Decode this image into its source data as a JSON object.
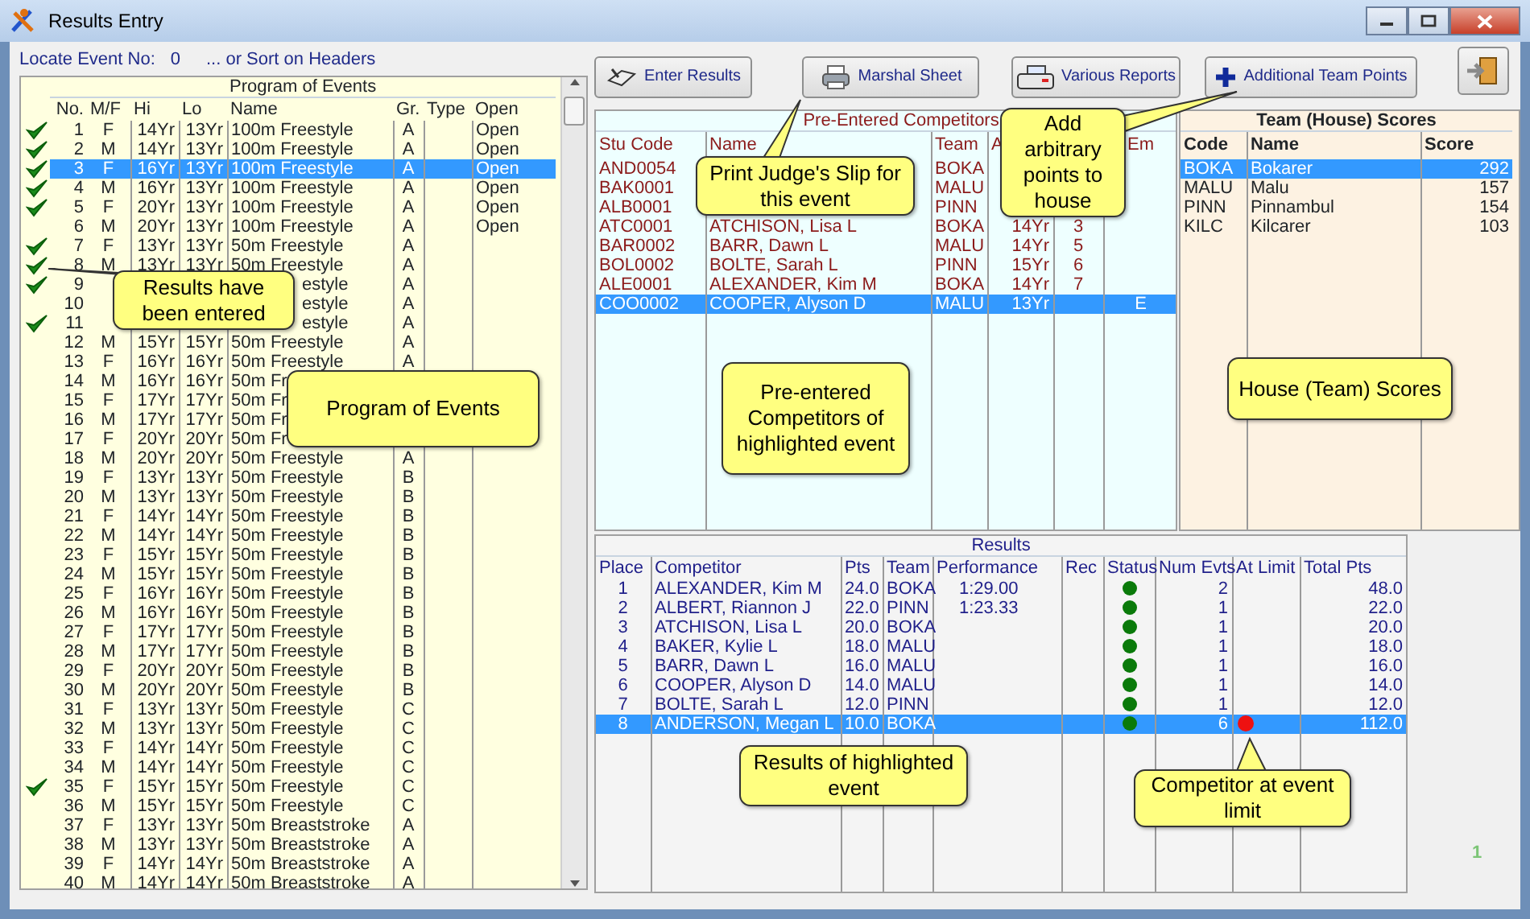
{
  "window": {
    "title": "Results Entry"
  },
  "locate": {
    "label": "Locate Event No:",
    "value": "0",
    "hint": "... or Sort on Headers"
  },
  "events": {
    "title": "Program of Events",
    "columns": [
      "No.",
      "M/F",
      "Hi",
      "Lo",
      "Name",
      "Gr.",
      "Type",
      "Open"
    ],
    "rows": [
      {
        "no": "1",
        "mf": "F",
        "hi": "14Yr",
        "lo": "13Yr",
        "name": "100m Freestyle",
        "gr": "A",
        "open": "Open",
        "entered": true,
        "selected": false
      },
      {
        "no": "2",
        "mf": "M",
        "hi": "14Yr",
        "lo": "13Yr",
        "name": "100m Freestyle",
        "gr": "A",
        "open": "Open",
        "entered": true,
        "selected": false
      },
      {
        "no": "3",
        "mf": "F",
        "hi": "16Yr",
        "lo": "13Yr",
        "name": "100m Freestyle",
        "gr": "A",
        "open": "Open",
        "entered": true,
        "selected": true
      },
      {
        "no": "4",
        "mf": "M",
        "hi": "16Yr",
        "lo": "13Yr",
        "name": "100m Freestyle",
        "gr": "A",
        "open": "Open",
        "entered": true,
        "selected": false
      },
      {
        "no": "5",
        "mf": "F",
        "hi": "20Yr",
        "lo": "13Yr",
        "name": "100m Freestyle",
        "gr": "A",
        "open": "Open",
        "entered": true,
        "selected": false
      },
      {
        "no": "6",
        "mf": "M",
        "hi": "20Yr",
        "lo": "13Yr",
        "name": "100m Freestyle",
        "gr": "A",
        "open": "Open",
        "entered": false,
        "selected": false
      },
      {
        "no": "7",
        "mf": "F",
        "hi": "13Yr",
        "lo": "13Yr",
        "name": "50m Freestyle",
        "gr": "A",
        "entered": true,
        "selected": false
      },
      {
        "no": "8",
        "mf": "M",
        "hi": "13Yr",
        "lo": "13Yr",
        "name": "50m Freestyle",
        "gr": "A",
        "entered": true,
        "selected": false
      },
      {
        "no": "9",
        "name": "estyle",
        "gr": "A",
        "entered": true,
        "selected": false
      },
      {
        "no": "10",
        "name": "estyle",
        "gr": "A",
        "entered": false,
        "selected": false
      },
      {
        "no": "11",
        "name": "estyle",
        "gr": "A",
        "entered": true,
        "selected": false
      },
      {
        "no": "12",
        "mf": "M",
        "hi": "15Yr",
        "lo": "15Yr",
        "name": "50m Freestyle",
        "gr": "A",
        "entered": false,
        "selected": false
      },
      {
        "no": "13",
        "mf": "F",
        "hi": "16Yr",
        "lo": "16Yr",
        "name": "50m Freestyle",
        "gr": "A",
        "entered": false,
        "selected": false
      },
      {
        "no": "14",
        "mf": "M",
        "hi": "16Yr",
        "lo": "16Yr",
        "name": "50m Fr",
        "entered": false,
        "selected": false
      },
      {
        "no": "15",
        "mf": "F",
        "hi": "17Yr",
        "lo": "17Yr",
        "name": "50m Fr",
        "entered": false,
        "selected": false
      },
      {
        "no": "16",
        "mf": "M",
        "hi": "17Yr",
        "lo": "17Yr",
        "name": "50m Fr",
        "entered": false,
        "selected": false
      },
      {
        "no": "17",
        "mf": "F",
        "hi": "20Yr",
        "lo": "20Yr",
        "name": "50m Fr",
        "entered": false,
        "selected": false
      },
      {
        "no": "18",
        "mf": "M",
        "hi": "20Yr",
        "lo": "20Yr",
        "name": "50m Freestyle",
        "gr": "A",
        "entered": false,
        "selected": false
      },
      {
        "no": "19",
        "mf": "F",
        "hi": "13Yr",
        "lo": "13Yr",
        "name": "50m Freestyle",
        "gr": "B",
        "entered": false,
        "selected": false
      },
      {
        "no": "20",
        "mf": "M",
        "hi": "13Yr",
        "lo": "13Yr",
        "name": "50m Freestyle",
        "gr": "B",
        "entered": false,
        "selected": false
      },
      {
        "no": "21",
        "mf": "F",
        "hi": "14Yr",
        "lo": "14Yr",
        "name": "50m Freestyle",
        "gr": "B",
        "entered": false,
        "selected": false
      },
      {
        "no": "22",
        "mf": "M",
        "hi": "14Yr",
        "lo": "14Yr",
        "name": "50m Freestyle",
        "gr": "B",
        "entered": false,
        "selected": false
      },
      {
        "no": "23",
        "mf": "F",
        "hi": "15Yr",
        "lo": "15Yr",
        "name": "50m Freestyle",
        "gr": "B",
        "entered": false,
        "selected": false
      },
      {
        "no": "24",
        "mf": "M",
        "hi": "15Yr",
        "lo": "15Yr",
        "name": "50m Freestyle",
        "gr": "B",
        "entered": false,
        "selected": false
      },
      {
        "no": "25",
        "mf": "F",
        "hi": "16Yr",
        "lo": "16Yr",
        "name": "50m Freestyle",
        "gr": "B",
        "entered": false,
        "selected": false
      },
      {
        "no": "26",
        "mf": "M",
        "hi": "16Yr",
        "lo": "16Yr",
        "name": "50m Freestyle",
        "gr": "B",
        "entered": false,
        "selected": false
      },
      {
        "no": "27",
        "mf": "F",
        "hi": "17Yr",
        "lo": "17Yr",
        "name": "50m Freestyle",
        "gr": "B",
        "entered": false,
        "selected": false
      },
      {
        "no": "28",
        "mf": "M",
        "hi": "17Yr",
        "lo": "17Yr",
        "name": "50m Freestyle",
        "gr": "B",
        "entered": false,
        "selected": false
      },
      {
        "no": "29",
        "mf": "F",
        "hi": "20Yr",
        "lo": "20Yr",
        "name": "50m Freestyle",
        "gr": "B",
        "entered": false,
        "selected": false
      },
      {
        "no": "30",
        "mf": "M",
        "hi": "20Yr",
        "lo": "20Yr",
        "name": "50m Freestyle",
        "gr": "B",
        "entered": false,
        "selected": false
      },
      {
        "no": "31",
        "mf": "F",
        "hi": "13Yr",
        "lo": "13Yr",
        "name": "50m Freestyle",
        "gr": "C",
        "entered": false,
        "selected": false
      },
      {
        "no": "32",
        "mf": "M",
        "hi": "13Yr",
        "lo": "13Yr",
        "name": "50m Freestyle",
        "gr": "C",
        "entered": false,
        "selected": false
      },
      {
        "no": "33",
        "mf": "F",
        "hi": "14Yr",
        "lo": "14Yr",
        "name": "50m Freestyle",
        "gr": "C",
        "entered": false,
        "selected": false
      },
      {
        "no": "34",
        "mf": "M",
        "hi": "14Yr",
        "lo": "14Yr",
        "name": "50m Freestyle",
        "gr": "C",
        "entered": false,
        "selected": false
      },
      {
        "no": "35",
        "mf": "F",
        "hi": "15Yr",
        "lo": "15Yr",
        "name": "50m Freestyle",
        "gr": "C",
        "entered": true,
        "selected": false
      },
      {
        "no": "36",
        "mf": "M",
        "hi": "15Yr",
        "lo": "15Yr",
        "name": "50m Freestyle",
        "gr": "C",
        "entered": false,
        "selected": false
      },
      {
        "no": "37",
        "mf": "F",
        "hi": "13Yr",
        "lo": "13Yr",
        "name": "50m Breaststroke",
        "gr": "A",
        "entered": false,
        "selected": false
      },
      {
        "no": "38",
        "mf": "M",
        "hi": "13Yr",
        "lo": "13Yr",
        "name": "50m Breaststroke",
        "gr": "A",
        "entered": false,
        "selected": false
      },
      {
        "no": "39",
        "mf": "F",
        "hi": "14Yr",
        "lo": "14Yr",
        "name": "50m Breaststroke",
        "gr": "A",
        "entered": false,
        "selected": false
      },
      {
        "no": "40",
        "mf": "M",
        "hi": "14Yr",
        "lo": "14Yr",
        "name": "50m Breaststroke",
        "gr": "A",
        "entered": false,
        "selected": false
      }
    ]
  },
  "toolbar": [
    {
      "label": "Enter Results",
      "kind": "enter"
    },
    {
      "label": "Marshal Sheet",
      "kind": "printer"
    },
    {
      "label": "Various Reports",
      "kind": "reports"
    },
    {
      "label": "Additional Team Points",
      "kind": "plus"
    },
    {
      "kind": "exit"
    }
  ],
  "pre_entered": {
    "title": "Pre-Entered Competitors",
    "columns": [
      "Stu Code",
      "Name",
      "Team",
      "A",
      "",
      "Em"
    ],
    "rows": [
      {
        "code": "AND0054",
        "team": "BOKA",
        "selected": false
      },
      {
        "code": "BAK0001",
        "team": "MALU",
        "selected": false
      },
      {
        "code": "ALB0001",
        "team": "PINN",
        "selected": false
      },
      {
        "code": "ATC0001",
        "name": "ATCHISON, Lisa L",
        "team": "BOKA",
        "age": "14Yr",
        "col5": "3",
        "selected": false
      },
      {
        "code": "BAR0002",
        "name": "BARR, Dawn L",
        "team": "MALU",
        "age": "14Yr",
        "col5": "5",
        "selected": false
      },
      {
        "code": "BOL0002",
        "name": "BOLTE, Sarah L",
        "team": "PINN",
        "age": "15Yr",
        "col5": "6",
        "selected": false
      },
      {
        "code": "ALE0001",
        "name": "ALEXANDER, Kim M",
        "team": "BOKA",
        "age": "14Yr",
        "col5": "7",
        "selected": false
      },
      {
        "code": "COO0002",
        "name": "COOPER, Alyson D",
        "team": "MALU",
        "age": "13Yr",
        "em": "E",
        "selected": true
      }
    ]
  },
  "team_scores": {
    "title": "Team (House) Scores",
    "columns": [
      "Code",
      "Name",
      "Score"
    ],
    "rows": [
      {
        "code": "BOKA",
        "name": "Bokarer",
        "score": "292",
        "selected": true
      },
      {
        "code": "MALU",
        "name": "Malu",
        "score": "157",
        "selected": false
      },
      {
        "code": "PINN",
        "name": "Pinnambul",
        "score": "154",
        "selected": false
      },
      {
        "code": "KILC",
        "name": "Kilcarer",
        "score": "103",
        "selected": false
      }
    ]
  },
  "results": {
    "title": "Results",
    "columns": [
      "Place",
      "Competitor",
      "Pts",
      "Team",
      "Performance",
      "Rec",
      "Status",
      "Num Evts",
      "At Limit",
      "Total Pts"
    ],
    "rows": [
      {
        "place": "1",
        "competitor": "ALEXANDER, Kim M",
        "pts": "24.0",
        "team": "BOKA",
        "performance": "1:29.00",
        "status_ok": true,
        "num_evts": "2",
        "at_limit": false,
        "total": "48.0",
        "selected": false
      },
      {
        "place": "2",
        "competitor": "ALBERT, Riannon J",
        "pts": "22.0",
        "team": "PINN",
        "performance": "1:23.33",
        "status_ok": true,
        "num_evts": "1",
        "at_limit": false,
        "total": "22.0",
        "selected": false
      },
      {
        "place": "3",
        "competitor": "ATCHISON, Lisa L",
        "pts": "20.0",
        "team": "BOKA",
        "status_ok": true,
        "num_evts": "1",
        "at_limit": false,
        "total": "20.0",
        "selected": false
      },
      {
        "place": "4",
        "competitor": "BAKER, Kylie L",
        "pts": "18.0",
        "team": "MALU",
        "status_ok": true,
        "num_evts": "1",
        "at_limit": false,
        "total": "18.0",
        "selected": false
      },
      {
        "place": "5",
        "competitor": "BARR, Dawn L",
        "pts": "16.0",
        "team": "MALU",
        "status_ok": true,
        "num_evts": "1",
        "at_limit": false,
        "total": "16.0",
        "selected": false
      },
      {
        "place": "6",
        "competitor": "COOPER, Alyson D",
        "pts": "14.0",
        "team": "MALU",
        "status_ok": true,
        "num_evts": "1",
        "at_limit": false,
        "total": "14.0",
        "selected": false
      },
      {
        "place": "7",
        "competitor": "BOLTE, Sarah L",
        "pts": "12.0",
        "team": "PINN",
        "status_ok": true,
        "num_evts": "1",
        "at_limit": false,
        "total": "12.0",
        "selected": false
      },
      {
        "place": "8",
        "competitor": "ANDERSON, Megan L",
        "pts": "10.0",
        "team": "BOKA",
        "status_ok": true,
        "num_evts": "6",
        "at_limit": true,
        "total": "112.0",
        "selected": true
      }
    ]
  },
  "page_number": "1",
  "callouts": [
    {
      "text": "Results have been entered"
    },
    {
      "text": "Program of Events"
    },
    {
      "text": "Print Judge's Slip for this event"
    },
    {
      "text": "Add arbitrary points to house"
    },
    {
      "text": "Pre-entered Competitors of highlighted event"
    },
    {
      "text": "House (Team) Scores"
    },
    {
      "text": "Results of highlighted event"
    },
    {
      "text": "Competitor at event limit"
    }
  ]
}
